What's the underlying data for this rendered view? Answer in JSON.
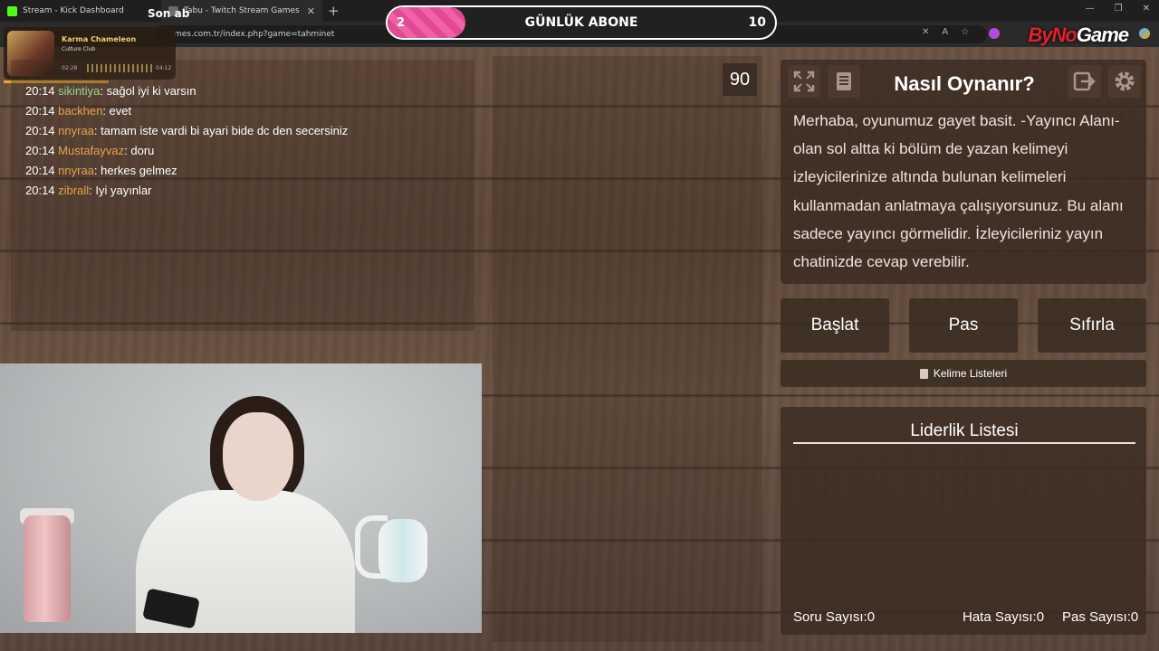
{
  "browser": {
    "tabs": [
      {
        "title": "Stream - Kick Dashboard",
        "active": false,
        "favicon_color": "#53fc18"
      },
      {
        "title": "Tabu - Twitch Stream Games",
        "active": true,
        "favicon_color": "#6b6b6b"
      }
    ],
    "new_tab": "+",
    "url": "mes.com.tr/index.php?game=tahminet",
    "brand": {
      "part1": "ByNo",
      "part2": "Game"
    }
  },
  "overlay": {
    "music": {
      "song": "Karma Chameleon",
      "artist": "Culture Club",
      "elapsed": "02:28",
      "total": "04:12"
    },
    "recent_label": "Son ab",
    "sub_goal": {
      "current": "2",
      "title": "GÜNLÜK ABONE",
      "goal": "10",
      "fill_fraction": 0.2,
      "color": "#f062a5"
    }
  },
  "chat": {
    "messages": [
      {
        "time": "20:14",
        "user": "sikintiya",
        "text": ": sağol iyi ki varsın",
        "user_color": "#9bd48f"
      },
      {
        "time": "20:14",
        "user": "backhen",
        "text": ": evet",
        "user_color": "#e8a24d"
      },
      {
        "time": "20:14",
        "user": "nnyraa",
        "text": ": tamam iste vardi bi ayari bide dc den secersiniz",
        "user_color": "#e8a24d"
      },
      {
        "time": "20:14",
        "user": "Mustafayvaz",
        "text": ": doru",
        "user_color": "#e8a24d"
      },
      {
        "time": "20:14",
        "user": "nnyraa",
        "text": ": herkes gelmez",
        "user_color": "#e8a24d"
      },
      {
        "time": "20:14",
        "user": "zibrall",
        "text": ": Iyi yayınlar",
        "user_color": "#e8a24d"
      }
    ]
  },
  "game": {
    "timer": "90",
    "how_to_play_title": "Nasıl Oynanır?",
    "how_to_play_text": "Merhaba, oyunumuz gayet basit. -Yayıncı Alanı- olan sol altta ki bölüm de yazan kelimeyi izleyicilerinize altında bulunan kelimeleri kullanmadan anlatmaya çalışıyorsunuz. Bu alanı sadece yayıncı görmelidir. İzleyicileriniz yayın chatinizde cevap verebilir.",
    "buttons": {
      "start": "Başlat",
      "pass": "Pas",
      "reset": "Sıfırla"
    },
    "word_lists": "Kelime Listeleri",
    "leaderboard_title": "Liderlik Listesi",
    "stats": {
      "questions_label": "Soru Sayısı:",
      "questions": "0",
      "errors_label": "Hata Sayısı:",
      "errors": "0",
      "passes_label": "Pas Sayısı:",
      "passes": "0"
    }
  }
}
